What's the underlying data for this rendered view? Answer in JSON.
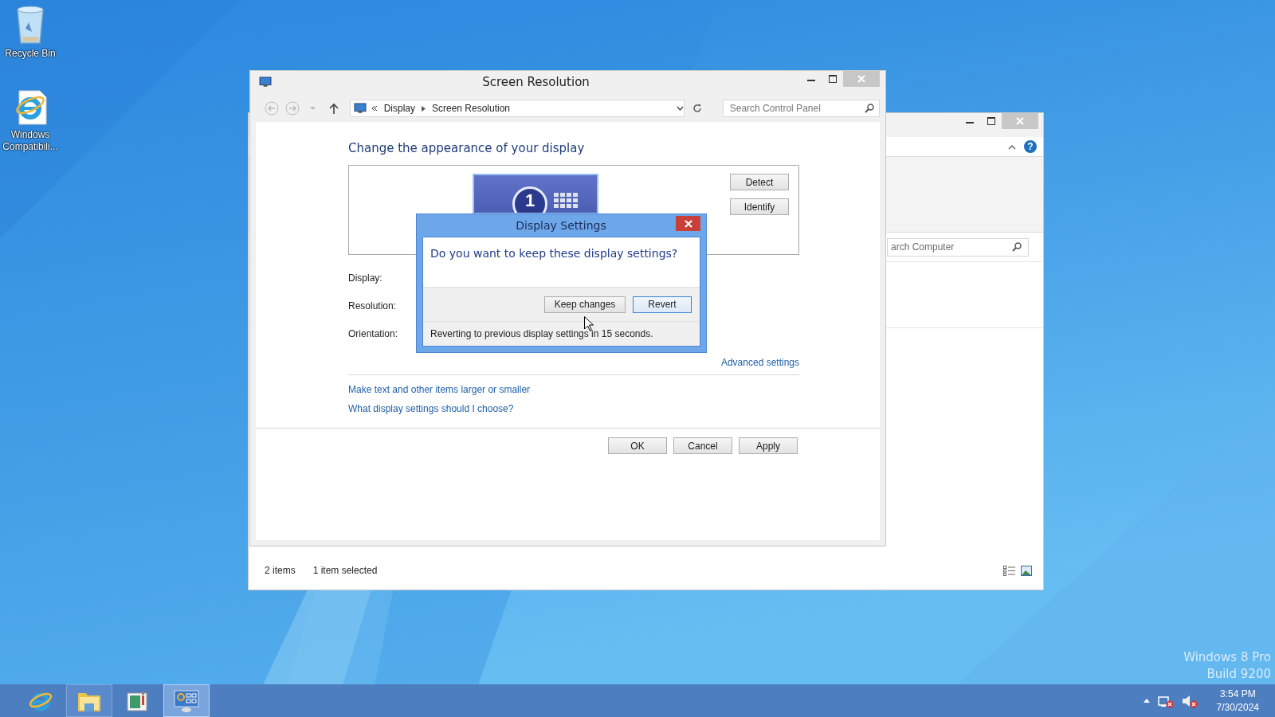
{
  "desktop_icons": [
    {
      "kind": "recycle-bin",
      "label": "Recycle Bin"
    },
    {
      "kind": "browser-shortcut",
      "label": "Windows Compatibili..."
    }
  ],
  "back_window": {
    "help_button": "?",
    "search": {
      "placeholder": "arch Computer"
    },
    "status_bar": {
      "item_count": "2 items",
      "selection": "1 item selected"
    }
  },
  "main_window": {
    "title": "Screen Resolution",
    "breadcrumb": [
      {
        "label": "Display"
      },
      {
        "label": "Screen Resolution"
      }
    ],
    "search": {
      "placeholder": "Search Control Panel"
    },
    "heading": "Change the appearance of your display",
    "monitor_number": "1",
    "side_buttons": [
      "Detect",
      "Identify"
    ],
    "field_labels": [
      "Display:",
      "Resolution:",
      "Orientation:"
    ],
    "advanced_link": "Advanced settings",
    "links": [
      "Make text and other items larger or smaller",
      "What display settings should I choose?"
    ],
    "footer_buttons": [
      "OK",
      "Cancel",
      "Apply"
    ]
  },
  "dialog": {
    "title": "Display Settings",
    "question": "Do you want to keep these display settings?",
    "buttons": [
      {
        "label": "Keep changes",
        "focused": false
      },
      {
        "label": "Revert",
        "focused": true
      }
    ],
    "countdown": "Reverting to previous display settings in 15 seconds."
  },
  "os_watermark": {
    "edition": "Windows 8 Pro",
    "build": "Build 9200"
  },
  "taskbar": {
    "apps": [
      {
        "kind": "browser",
        "running": false,
        "selected": false
      },
      {
        "kind": "folder",
        "running": true,
        "selected": false
      },
      {
        "kind": "window",
        "running": false,
        "selected": false
      },
      {
        "kind": "monitor",
        "running": true,
        "selected": true
      }
    ],
    "time": "3:54 PM",
    "date": "7/30/2024"
  }
}
